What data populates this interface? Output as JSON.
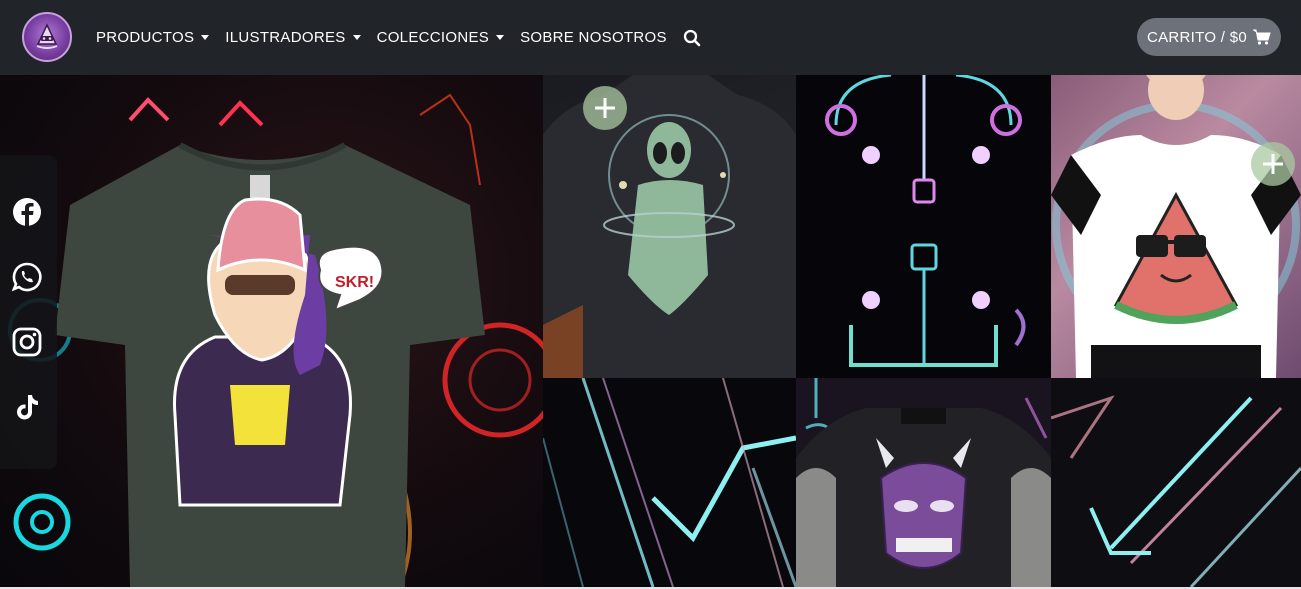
{
  "nav": {
    "logo_icon": "wizard-hat-logo",
    "items": [
      {
        "label": "PRODUCTOS",
        "dropdown": true
      },
      {
        "label": "ILUSTRADORES",
        "dropdown": true
      },
      {
        "label": "COLECCIONES",
        "dropdown": true
      },
      {
        "label": "SOBRE NOSOTROS",
        "dropdown": false
      }
    ],
    "search_icon": "search-icon",
    "cart_label": "CARRITO / $0",
    "cart_icon": "cart-icon"
  },
  "social": [
    "facebook-icon",
    "whatsapp-icon",
    "instagram-icon",
    "tiktok-icon"
  ],
  "hero": {
    "speech_text": "SKR!"
  },
  "tiles": [
    {
      "name": "alien-tshirt",
      "has_add": true
    },
    {
      "name": "neon-headphones-art",
      "has_add": false
    },
    {
      "name": "watermelon-tshirt",
      "has_add": true
    },
    {
      "name": "neon-lines-art",
      "has_add": false
    },
    {
      "name": "oni-mask-tshirt",
      "has_add": false
    },
    {
      "name": "neon-diagonal-art",
      "has_add": false
    }
  ],
  "colors": {
    "navbar": "#212429",
    "cart_button": "#6c717a",
    "plus_button": "#aac8a0"
  }
}
